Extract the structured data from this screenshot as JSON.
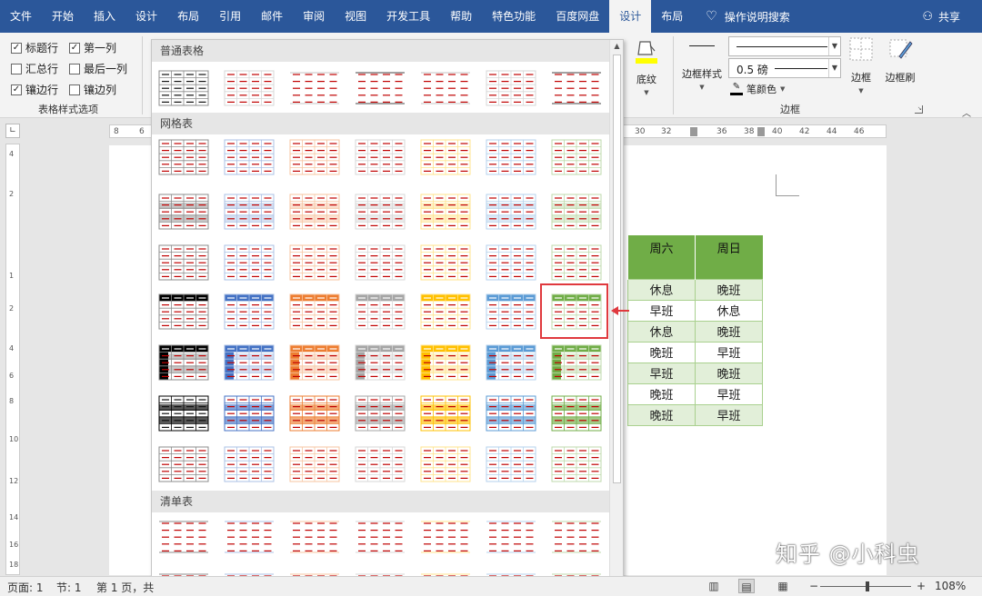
{
  "menu": {
    "tabs": [
      "文件",
      "开始",
      "插入",
      "设计",
      "布局",
      "引用",
      "邮件",
      "审阅",
      "视图",
      "开发工具",
      "帮助",
      "特色功能",
      "百度网盘",
      "设计",
      "布局"
    ],
    "tell_me": "操作说明搜索",
    "share": "共享"
  },
  "ribbon": {
    "options": {
      "header_row": "标题行",
      "first_column": "第一列",
      "total_row": "汇总行",
      "last_column": "最后一列",
      "banded_rows": "镶边行",
      "banded_columns": "镶边列",
      "group_label": "表格样式选项"
    },
    "shading_label": "底纹",
    "border_style_label": "边框样式",
    "line_weight": "0.5 磅",
    "pen_color_label": "笔颜色",
    "borders_label": "边框",
    "border_painter_label": "边框刷",
    "borders_group_label": "边框"
  },
  "ruler": {
    "left_ticks": [
      "8",
      "6"
    ],
    "right_ticks": [
      "30",
      "32",
      "36",
      "38",
      "40",
      "42",
      "44",
      "46"
    ],
    "vertical_ticks": [
      "4",
      "2",
      "1",
      "2",
      "4",
      "6",
      "8",
      "10",
      "12",
      "14",
      "16",
      "18"
    ]
  },
  "gallery": {
    "sections": [
      "普通表格",
      "网格表",
      "清单表"
    ],
    "palette": [
      "#000000",
      "#4472c4",
      "#ed7d31",
      "#a5a5a5",
      "#ffc000",
      "#5b9bd5",
      "#70ad47"
    ],
    "rule_color": "#c00000"
  },
  "document": {
    "table": {
      "headers": [
        "周六",
        "周日"
      ],
      "rows": [
        [
          "休息",
          "晚班"
        ],
        [
          "早班",
          "休息"
        ],
        [
          "休息",
          "晚班"
        ],
        [
          "晚班",
          "早班"
        ],
        [
          "早班",
          "晚班"
        ],
        [
          "晚班",
          "早班"
        ],
        [
          "晚班",
          "早班"
        ]
      ]
    },
    "watermark": "知乎 @小科虫"
  },
  "status": {
    "page": "页面: 1",
    "section": "节: 1",
    "page_of": "第 1 页，共",
    "zoom_minus": "−",
    "zoom_plus": "+",
    "zoom": "108%"
  }
}
